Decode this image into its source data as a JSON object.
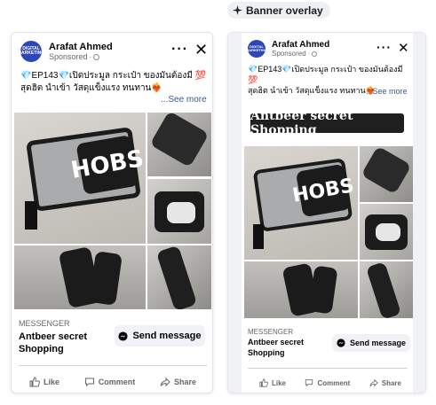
{
  "overlay": {
    "label": "Banner overlay",
    "icon": "sparkle-icon"
  },
  "ad": {
    "page_name": "Arafat Ahmed",
    "sponsored": "Sponsored",
    "avatar_text": "DIGITAL MARKETING",
    "caption_line1": "💎EP143💎เปิดประมูล กระเป๋า ของมันต้องมี 💯",
    "caption_line2": "สุดฮิต นำเข้า วัสดุแข็งแรง ทนทาน❤️‍🔥",
    "see_more": "...See more",
    "banner_text": "Antbeer secret Shopping",
    "photo_text": "HOBS",
    "cta_label": "MESSENGER",
    "cta_title": "Antbeer secret Shopping",
    "send_message": "Send message",
    "like": "Like",
    "comment": "Comment",
    "share": "Share"
  },
  "colors": {
    "accent": "#385898",
    "bag_gray": "#a9abad",
    "bag_black": "#1b1b1b",
    "avatar": "#2d46b9"
  }
}
